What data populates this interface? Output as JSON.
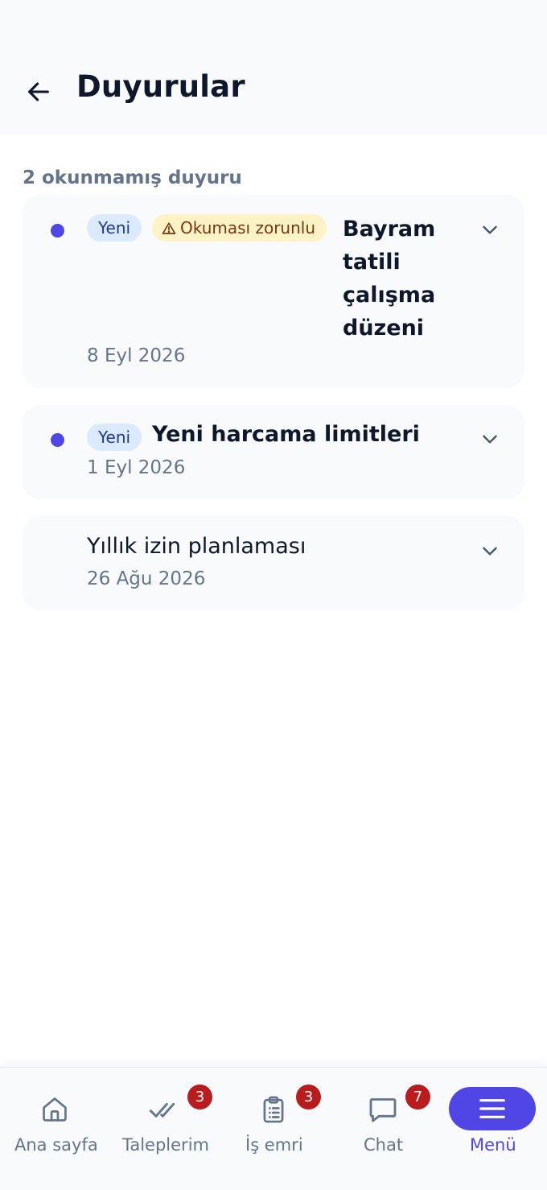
{
  "header": {
    "title": "Duyurular",
    "back_icon": "arrow-left-icon"
  },
  "summary": "2 okunmamış duyuru",
  "colors": {
    "accent": "#4f46e5",
    "new_badge_bg": "#dbeafe",
    "mandatory_badge_bg": "#fef3c7",
    "notification_badge": "#b91c1c"
  },
  "announcements": [
    {
      "unread": true,
      "badge_new": "Yeni",
      "badge_mandatory": "Okuması zorunlu",
      "title_lines": [
        "Bayram",
        "tatili",
        "çalışma",
        "düzeni"
      ],
      "date": "8 Eyl 2026"
    },
    {
      "unread": true,
      "badge_new": "Yeni",
      "title": "Yeni harcama limitleri",
      "date": "1 Eyl 2026"
    },
    {
      "unread": false,
      "title": "Yıllık izin planlaması",
      "date": "26 Ağu 2026"
    }
  ],
  "bottom_nav": [
    {
      "label": "Ana sayfa",
      "icon": "home-icon"
    },
    {
      "label": "Taleplerim",
      "icon": "double-check-icon",
      "badge": "3"
    },
    {
      "label": "İş emri",
      "icon": "clipboard-icon",
      "badge": "3"
    },
    {
      "label": "Chat",
      "icon": "chat-bubble-icon",
      "badge": "7"
    },
    {
      "label": "Menü",
      "icon": "hamburger-menu-icon",
      "active": true
    }
  ]
}
